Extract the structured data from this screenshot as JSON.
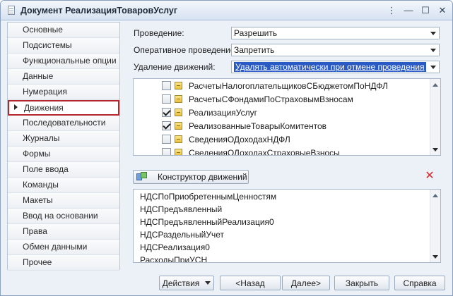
{
  "window": {
    "title": "Документ РеализацияТоваровУслуг"
  },
  "sidebar": {
    "items": [
      {
        "label": "Основные"
      },
      {
        "label": "Подсистемы"
      },
      {
        "label": "Функциональные опции"
      },
      {
        "label": "Данные"
      },
      {
        "label": "Нумерация"
      },
      {
        "label": "Движения"
      },
      {
        "label": "Последовательности"
      },
      {
        "label": "Журналы"
      },
      {
        "label": "Формы"
      },
      {
        "label": "Поле ввода"
      },
      {
        "label": "Команды"
      },
      {
        "label": "Макеты"
      },
      {
        "label": "Ввод на основании"
      },
      {
        "label": "Права"
      },
      {
        "label": "Обмен данными"
      },
      {
        "label": "Прочее"
      }
    ],
    "active_index": 5
  },
  "settings": {
    "posting": {
      "label": "Проведение:",
      "value": "Разрешить"
    },
    "realtime_posting": {
      "label": "Оперативное проведение:",
      "value": "Запретить"
    },
    "delete_movements": {
      "label": "Удаление движений:",
      "value": "Удалять автоматически при отмене проведения"
    }
  },
  "registers": [
    {
      "name": "РасчетыНалогоплательщиковСБюджетомПоНДФЛ",
      "checked": false
    },
    {
      "name": "РасчетыСФондамиПоСтраховымВзносам",
      "checked": false
    },
    {
      "name": "РеализацияУслуг",
      "checked": true
    },
    {
      "name": "РеализованныеТоварыКомитентов",
      "checked": true
    },
    {
      "name": "СведенияОДоходахНДФЛ",
      "checked": false
    },
    {
      "name": "СведенияОДоходахСтраховыеВзносы",
      "checked": false
    }
  ],
  "constructor_button": {
    "label": "Конструктор движений",
    "icon": "movement-constructor-icon"
  },
  "delete_icon": {
    "icon": "delete-icon",
    "color": "#d02a2a"
  },
  "accumulation_registers": [
    "НДСПоПриобретеннымЦенностям",
    "НДСПредъявленный",
    "НДСПредъявленныйРеализация0",
    "НДСРаздельныйУчет",
    "НДСРеализация0",
    "РасходыПриУСН"
  ],
  "footer": {
    "actions_label": "Действия",
    "back_label": "<Назад",
    "next_label": "Далее>",
    "close_label": "Закрыть",
    "help_label": "Справка"
  }
}
